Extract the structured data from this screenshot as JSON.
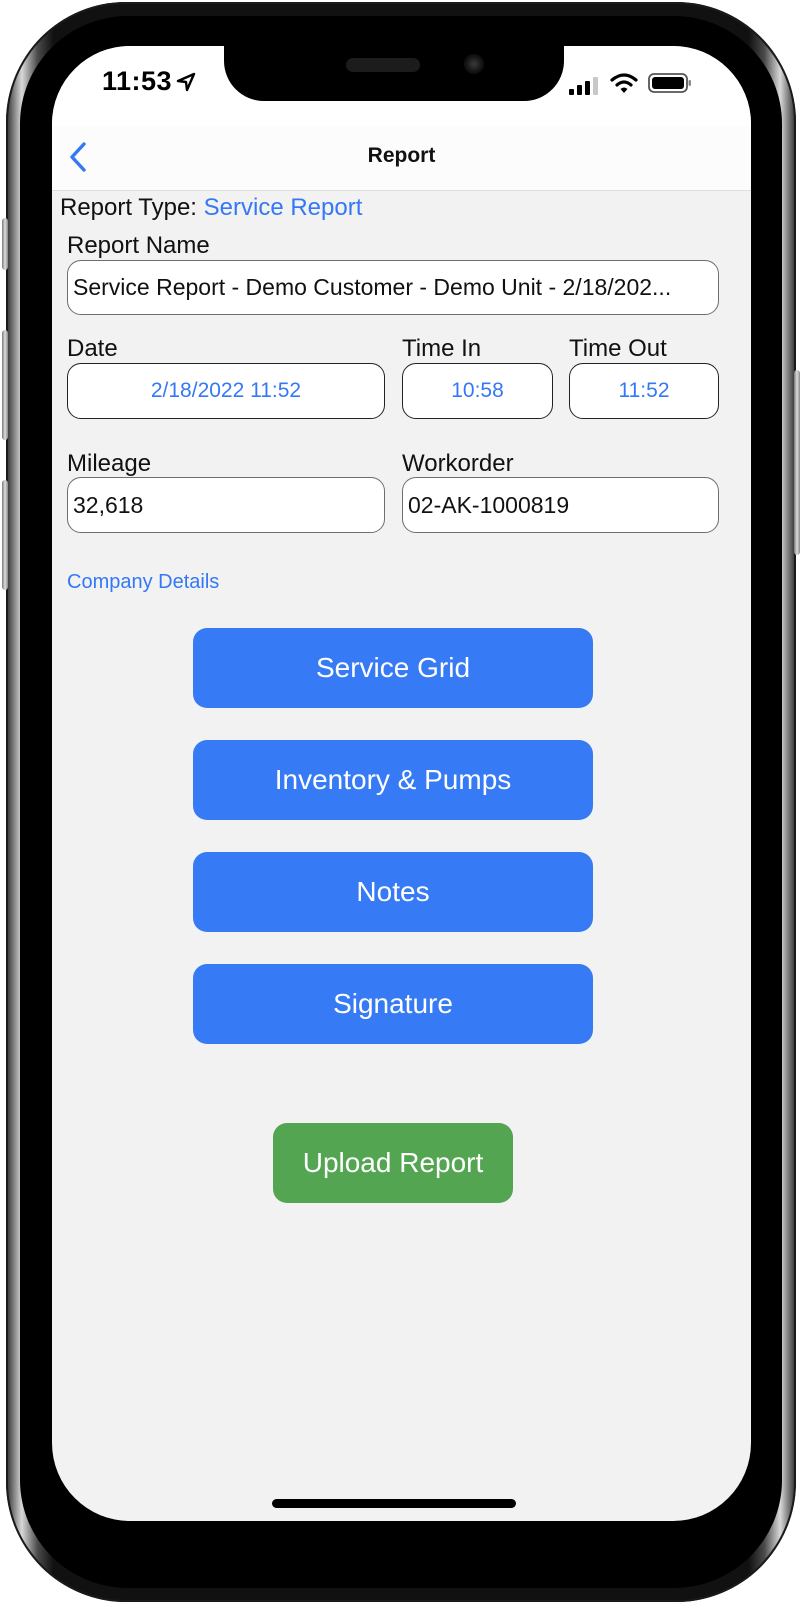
{
  "status_bar": {
    "time": "11:53",
    "location_icon": "location-arrow-icon",
    "signal_icon": "cellular-signal-icon",
    "wifi_icon": "wifi-icon",
    "battery_icon": "battery-icon"
  },
  "nav": {
    "back_icon": "chevron-left-icon",
    "title": "Report"
  },
  "form": {
    "report_type_label": "Report Type:",
    "report_type_value": "Service Report",
    "report_name_label": "Report Name",
    "report_name_value": "Service Report - Demo Customer - Demo Unit - 2/18/202...",
    "date_label": "Date",
    "date_value": "2/18/2022 11:52",
    "time_in_label": "Time In",
    "time_in_value": "10:58",
    "time_out_label": "Time Out",
    "time_out_value": "11:52",
    "mileage_label": "Mileage",
    "mileage_value": "32,618",
    "workorder_label": "Workorder",
    "workorder_value": "02-AK-1000819",
    "company_details_link": "Company Details"
  },
  "buttons": {
    "service_grid": "Service Grid",
    "inventory_pumps": "Inventory & Pumps",
    "notes": "Notes",
    "signature": "Signature",
    "upload_report": "Upload Report"
  },
  "colors": {
    "accent_blue": "#3478f6",
    "button_blue": "#367bf5",
    "button_green": "#53a552",
    "background": "#f2f2f2"
  }
}
